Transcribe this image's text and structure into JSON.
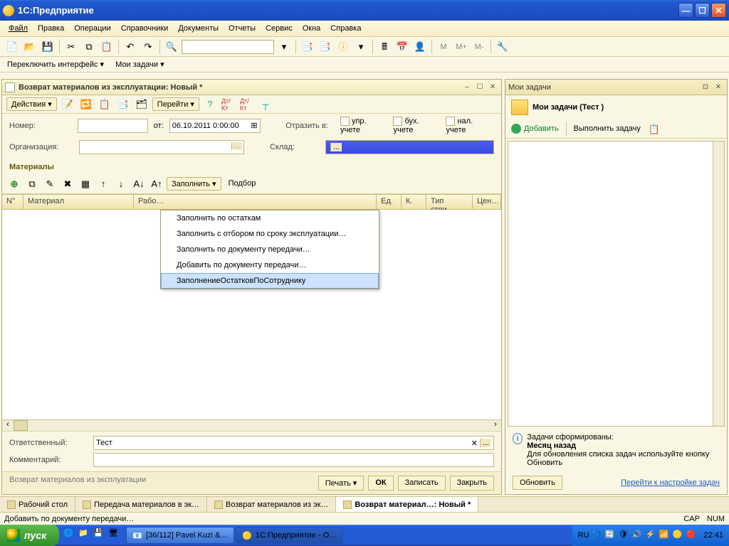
{
  "xp": {
    "title": "1С:Предприятие",
    "start": "пуск",
    "taskbar": {
      "btn1": "[36/112] Pavel Kuzi &…",
      "btn2": "1С:Предприятие - О…"
    },
    "clock": "22:41",
    "lang": "RU"
  },
  "menubar": {
    "file": "Файл",
    "edit": "Правка",
    "ops": "Операции",
    "ref": "Справочники",
    "docs": "Документы",
    "reports": "Отчеты",
    "service": "Сервис",
    "windows": "Окна",
    "help": "Справка"
  },
  "switchbar": {
    "a": "Переключить интерфейс ▾",
    "b": "Мои задачи ▾"
  },
  "toolbar_labels": {
    "m": "M",
    "mplus": "M+",
    "mminus": "M-"
  },
  "doc": {
    "title": "Возврат материалов из эксплуатации: Новый *",
    "tb": {
      "actions": "Действия ▾",
      "goto": "Перейти ▾",
      "dtkt1": "Дт/Кт",
      "dtkt2": "Дт/Кт"
    },
    "labels": {
      "number": "Номер:",
      "ot": "от:",
      "reflect": "Отразить в:",
      "upr": "упр. учете",
      "buh": "бух. учете",
      "nal": "нал. учете",
      "org": "Организация:",
      "sklad": "Склад:",
      "materials": "Материалы",
      "resp": "Ответственный:",
      "comment": "Комментарий:"
    },
    "date": "06.10.2011 0:00:00",
    "resp_value": "Тест",
    "gridtb": {
      "fill": "Заполнить ▾",
      "pick": "Подбор"
    },
    "cols": {
      "n": "N°",
      "mat": "Материал",
      "rab": "Рабо…",
      "ed": "Ед.",
      "k": "К.",
      "tip": "Тип стои…",
      "cen": "Цен…"
    },
    "menu": {
      "i1": "Заполнить по остаткам",
      "i2": "Заполнить с отбором по сроку эксплуатации…",
      "i3": "Заполнить по документу передачи…",
      "i4": "Добавить по документу передачи…",
      "i5": "ЗаполнениеОстатковПоСотруднику"
    },
    "footer": {
      "hint": "Возврат материалов из эксплуатации",
      "print": "Печать ▾",
      "ok": "ОК",
      "save": "Записать",
      "close": "Закрыть"
    }
  },
  "side": {
    "header": "Мои задачи",
    "title": "Мои задачи (Тест )",
    "add": "Добавить",
    "exec": "Выполнить задачу",
    "info_title": "Задачи сформированы:",
    "info_sub": "Месяц назад",
    "info_text": "Для обновления списка задач используйте кнопку Обновить",
    "refresh": "Обновить",
    "link": "Перейти к настройке задач"
  },
  "apptabs": {
    "t1": "Рабочий стол",
    "t2": "Передача материалов в эк…",
    "t3": "Возврат материалов из эк…",
    "t4": "Возврат материал…: Новый *"
  },
  "status": {
    "hint": "Добавить по документу передачи…",
    "cap": "CAP",
    "num": "NUM"
  }
}
